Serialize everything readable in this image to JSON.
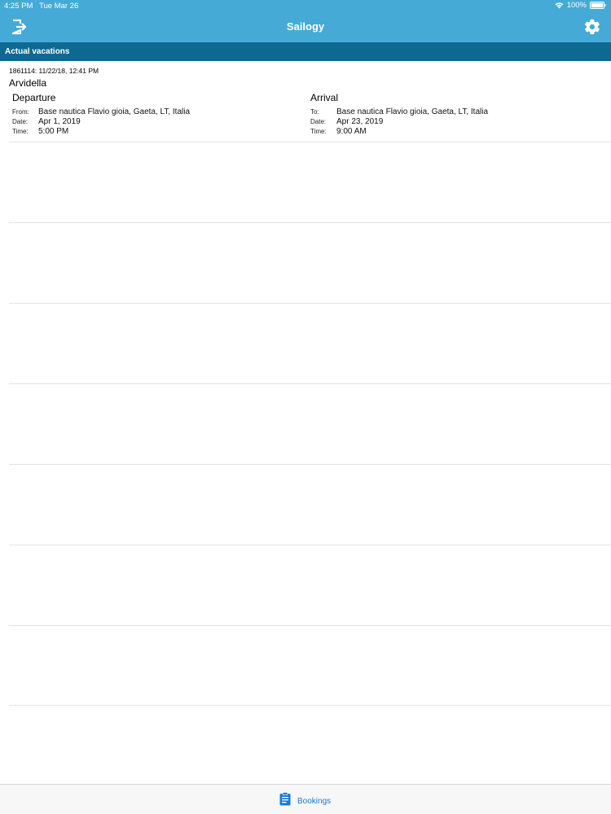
{
  "status_bar": {
    "time": "4:25 PM",
    "date": "Tue Mar 26",
    "battery": "100%"
  },
  "nav": {
    "title": "Sailogy",
    "left_icon": "logout-icon",
    "right_icon": "gear-icon"
  },
  "section": {
    "title": "Actual vacations"
  },
  "booking": {
    "meta": "1861114: 11/22/18, 12:41 PM",
    "boat_name": "Arvidella",
    "departure": {
      "title": "Departure",
      "from_label": "From:",
      "from_value": "Base nautica Flavio gioia, Gaeta, LT, Italia",
      "date_label": "Date:",
      "date_value": "Apr 1, 2019",
      "time_label": "Time:",
      "time_value": "5:00 PM"
    },
    "arrival": {
      "title": "Arrival",
      "to_label": "To:",
      "to_value": "Base nautica Flavio gioia, Gaeta, LT, Italia",
      "date_label": "Date:",
      "date_value": "Apr 23, 2019",
      "time_label": "Time:",
      "time_value": "9:00 AM"
    }
  },
  "tab_bar": {
    "bookings_label": "Bookings",
    "bookings_icon": "clipboard-icon"
  },
  "colors": {
    "nav_background": "#45aad6",
    "section_background": "#0e6990",
    "tab_active": "#1a7bd0",
    "separator": "#e3e3e3"
  }
}
